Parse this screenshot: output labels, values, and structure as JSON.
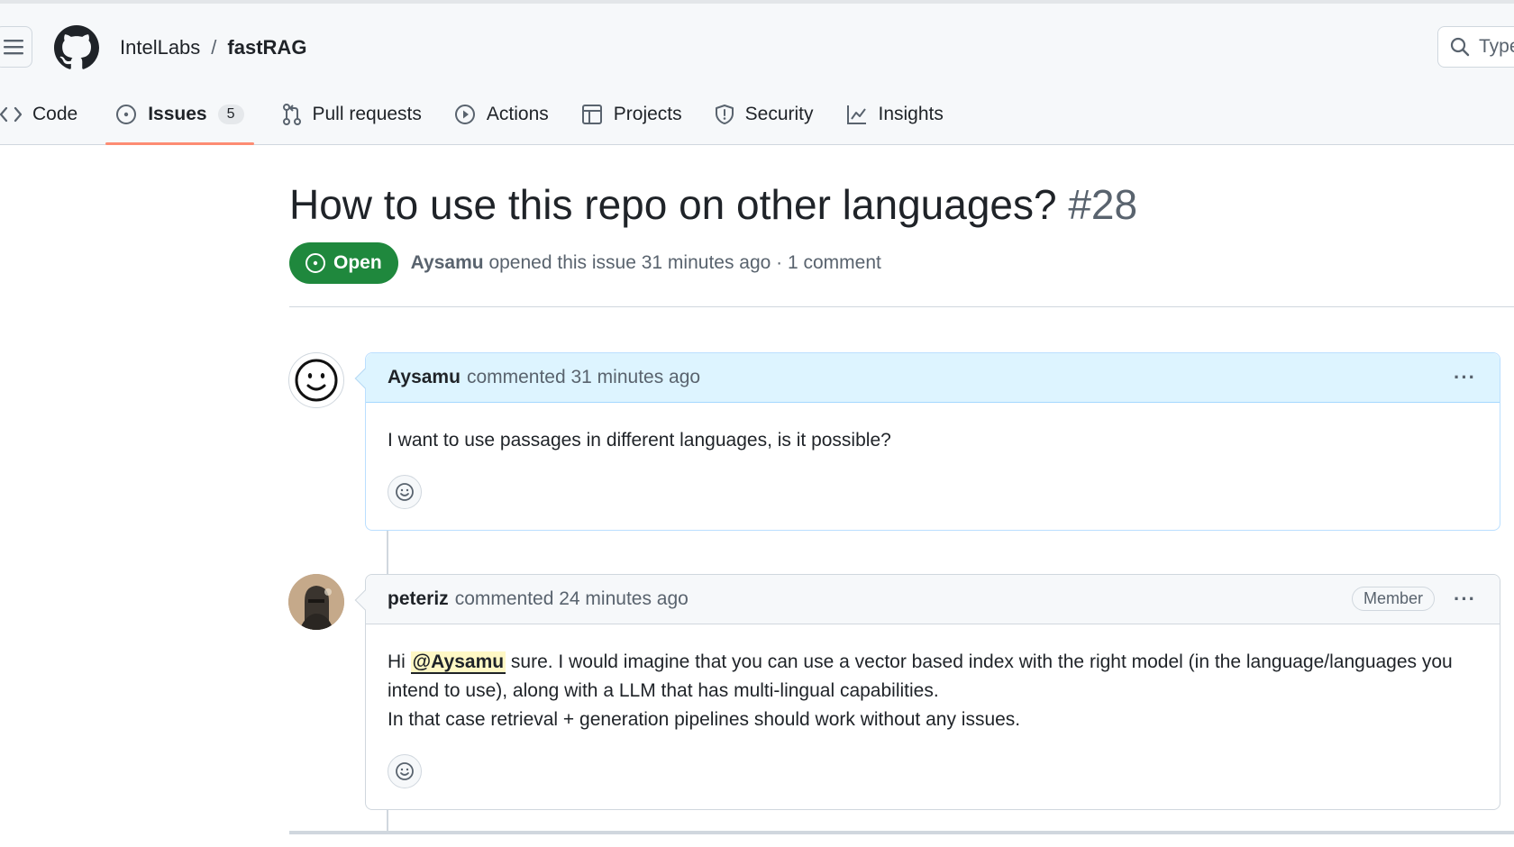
{
  "header": {
    "owner": "IntelLabs",
    "separator": "/",
    "repo": "fastRAG",
    "search_placeholder": "Type"
  },
  "tabs": [
    {
      "label": "Code",
      "icon": "code-icon"
    },
    {
      "label": "Issues",
      "icon": "issue-opened-icon",
      "count": "5",
      "selected": true
    },
    {
      "label": "Pull requests",
      "icon": "git-pull-request-icon"
    },
    {
      "label": "Actions",
      "icon": "play-icon"
    },
    {
      "label": "Projects",
      "icon": "table-icon"
    },
    {
      "label": "Security",
      "icon": "shield-icon"
    },
    {
      "label": "Insights",
      "icon": "graph-icon"
    }
  ],
  "issue": {
    "title": "How to use this repo on other languages?",
    "number": "#28",
    "state": "Open",
    "author": "Aysamu",
    "opened_text": "opened this issue 31 minutes ago · 1 comment"
  },
  "comments": [
    {
      "author": "Aysamu",
      "meta": "commented 31 minutes ago",
      "body": "I want to use passages in different languages, is it possible?",
      "actions": "···"
    },
    {
      "author": "peteriz",
      "meta": "commented 24 minutes ago",
      "role": "Member",
      "actions": "···",
      "body_prefix": "Hi ",
      "mention": "@Aysamu",
      "body_line1": " sure. I would imagine that you can use a vector based index with the right model (in the language/languages you intend to use), along with a LLM that has multi-lingual capabilities.",
      "body_line2": "In that case retrieval + generation pipelines should work without any issues."
    }
  ],
  "colors": {
    "open_green": "#1f883d",
    "tab_underline": "#fd8c73",
    "highlight_header": "#ddf4ff"
  }
}
